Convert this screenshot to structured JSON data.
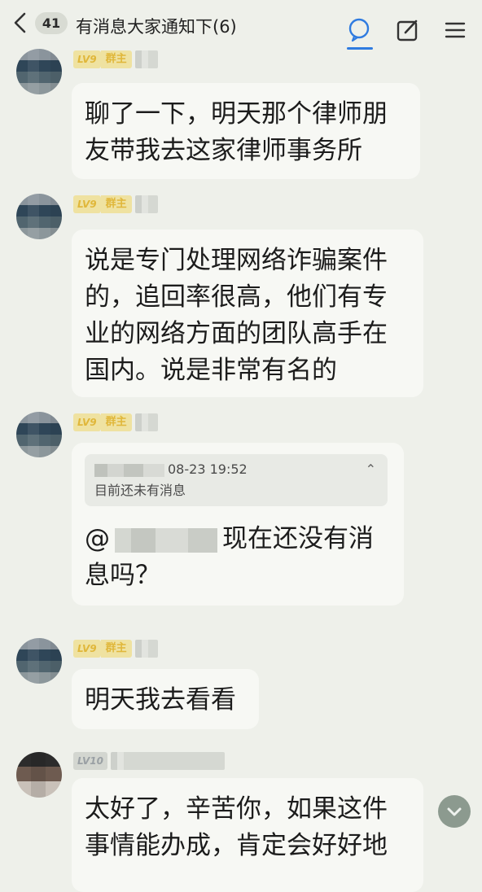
{
  "header": {
    "unread_count": "41",
    "title": "有消息大家通知下(6)",
    "accent_color": "#2f7be0",
    "icons": [
      "back-icon",
      "chat-icon",
      "edit-icon",
      "menu-icon"
    ]
  },
  "messages": [
    {
      "level": "LV9",
      "role": "群主",
      "text_lines": [
        "聊了一下，明天那个律师朋",
        "友带我去这家律师事务所"
      ]
    },
    {
      "level": "LV9",
      "role": "群主",
      "text_lines": [
        "说是专门处理网络诈骗案件",
        "的，追回率很高，他们有专",
        "业的网络方面的团队高手在",
        "国内。说是非常有名的"
      ]
    },
    {
      "level": "LV9",
      "role": "群主",
      "quote": {
        "time": "08-23 19:52",
        "text": "目前还未有消息",
        "collapse": "⌃"
      },
      "at": "@",
      "text_lines": [
        "现在还没有消",
        "息吗？"
      ]
    },
    {
      "level": "LV9",
      "role": "群主",
      "text_lines": [
        "明天我去看看"
      ]
    },
    {
      "level": "LV10",
      "text_lines": [
        "太好了，辛苦你，如果这件",
        "事情能办成，肯定会好好地"
      ]
    }
  ]
}
